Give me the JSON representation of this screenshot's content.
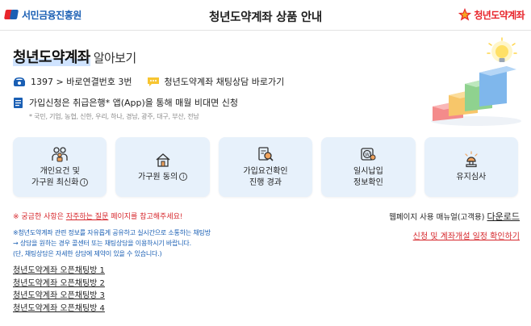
{
  "header": {
    "left_logo": "서민금융진흥원",
    "title": "청년도약계좌 상품 안내",
    "right_logo": "청년도약계좌"
  },
  "hero": {
    "title_highlight": "청년도약계좌",
    "title_rest": "알아보기",
    "phone": "1397 > 바로연결번호 3번",
    "chat": "청년도약계좌 채팅상담 바로가기",
    "apply": "가입신청은 취급은행* 앱(App)을 통해 매월 비대면 신청",
    "banks": "* 국민, 기업, 농협, 신한, 우리, 하나, 경남, 광주, 대구, 부산, 전남"
  },
  "cards": [
    {
      "label": "개인요건 및\n가구원 최신화",
      "info": "i",
      "icon": "family-icon"
    },
    {
      "label": "가구원 동의",
      "info": "i",
      "icon": "house-icon"
    },
    {
      "label": "가입요건확인\n진행 경과",
      "info": "",
      "icon": "document-search-icon"
    },
    {
      "label": "일시납입\n정보확인",
      "info": "",
      "icon": "coin-icon"
    },
    {
      "label": "유지심사",
      "info": "",
      "icon": "lamp-icon"
    }
  ],
  "notice1": {
    "prefix": "※ 궁금한 사항은 ",
    "link": "자주하는 질문",
    "suffix": " 페이지를 참고해주세요!"
  },
  "manual": {
    "text": "웹페이지 사용 매뉴얼(고객용) ",
    "link": "다운로드"
  },
  "schedule_link": "신청 및 계좌개설 일정 확인하기",
  "notice2": [
    "※청년도약계좌 관련 정보를 자유롭게 공유하고 실시간으로 소통하는 채팅방",
    "→ 상담을 원하는 경우 콜센터 또는 채팅상담을 이용하시기 바랍니다.",
    "(단, 채팅상담은 자세한 상담에 제약이 있을 수 있습니다.)"
  ],
  "chat_rooms": [
    "청년도약계좌 오픈채팅방 1",
    "청년도약계좌 오픈채팅방 2",
    "청년도약계좌 오픈채팅방 3",
    "청년도약계좌 오픈채팅방 4"
  ],
  "colors": {
    "accent_blue": "#1a5fb4",
    "accent_red": "#d6262b",
    "card_bg": "#e7f1fb"
  }
}
